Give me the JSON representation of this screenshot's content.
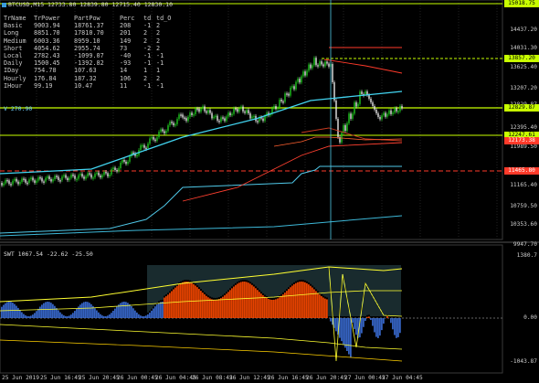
{
  "symbol_title": "BTCUSD,M15  12733.80 12839.80 12715.40 12830.10",
  "table": {
    "headers": [
      "TrName",
      "TrPower",
      "PartPow",
      "Perc",
      "td",
      "td_O"
    ],
    "rows": [
      [
        "Basic",
        "9003.94",
        "18761.37",
        "208",
        "-1",
        "2"
      ],
      [
        "Long",
        "8851.70",
        "17810.70",
        "201",
        "2",
        "2"
      ],
      [
        "Medium",
        "6003.36",
        "8959.10",
        "149",
        "2",
        "2"
      ],
      [
        "Short",
        "4054.62",
        "2955.74",
        "73",
        "-2",
        "2"
      ],
      [
        "Local",
        "2782.43",
        "-1099.07",
        "-40",
        "-1",
        "-1"
      ],
      [
        "Daily",
        "1500.45",
        "-1392.82",
        "-93",
        "-1",
        "-1"
      ],
      [
        "IDay",
        "754.78",
        "107.63",
        "14",
        "1",
        "1"
      ],
      [
        "Hourly",
        "176.84",
        "187.32",
        "106",
        "2",
        "2"
      ],
      [
        "IHour",
        "99.19",
        "10.47",
        "11",
        "-1",
        "-1"
      ]
    ]
  },
  "vline_label": "V  270.90",
  "price_axis": [
    "15018.75",
    "14437.20",
    "14031.30",
    "13625.40",
    "13207.20",
    "12829.87",
    "12395.40",
    "11989.50",
    "11165.40",
    "10759.50",
    "10353.60",
    "9947.70"
  ],
  "price_tags": [
    {
      "label": "15018.75",
      "color": "#c8ff00"
    },
    {
      "label": "13857.20",
      "color": "#c8ff00"
    },
    {
      "label": "12829.87",
      "color": "#c8ff00"
    },
    {
      "label": "12247.61",
      "color": "#c8ff00"
    },
    {
      "label": "12173.38",
      "color": "#ff3a2a"
    },
    {
      "label": "11465.80",
      "color": "#ff3a2a"
    }
  ],
  "time_axis": [
    "25 Jun 2019",
    "25 Jun 16:45",
    "25 Jun 20:45",
    "26 Jun 00:45",
    "26 Jun 04:45",
    "26 Jun 08:45",
    "26 Jun 12:45",
    "26 Jun 16:45",
    "26 Jun 20:45",
    "27 Jun 00:45",
    "27 Jun 04:45"
  ],
  "indicator": {
    "title": "SWT 1067.54 -22.62 -25.50",
    "axis": [
      "1380.7",
      "0.00",
      "-1043.87"
    ]
  }
}
